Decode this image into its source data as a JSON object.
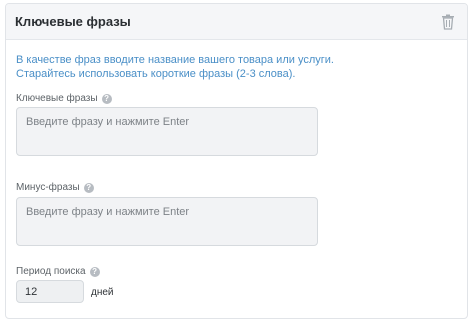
{
  "panel": {
    "title": "Ключевые фразы",
    "delete_icon": "trash-icon"
  },
  "description": {
    "line1": "В качестве фраз вводите название вашего товара или услуги.",
    "line2": "Старайтесь использовать короткие фразы (2-3 слова)."
  },
  "keywords": {
    "label": "Ключевые фразы",
    "help_icon": "question-icon",
    "placeholder": "Введите фразу и нажмите Enter",
    "value": ""
  },
  "minus_phrases": {
    "label": "Минус-фразы",
    "help_icon": "question-icon",
    "placeholder": "Введите фразу и нажмите Enter",
    "value": ""
  },
  "search_period": {
    "label": "Период поиска",
    "help_icon": "question-icon",
    "value": "12",
    "unit": "дней"
  },
  "colors": {
    "accent_text": "#4a8fc7",
    "header_bg": "#f5f6f8",
    "input_bg": "#f2f3f5"
  }
}
